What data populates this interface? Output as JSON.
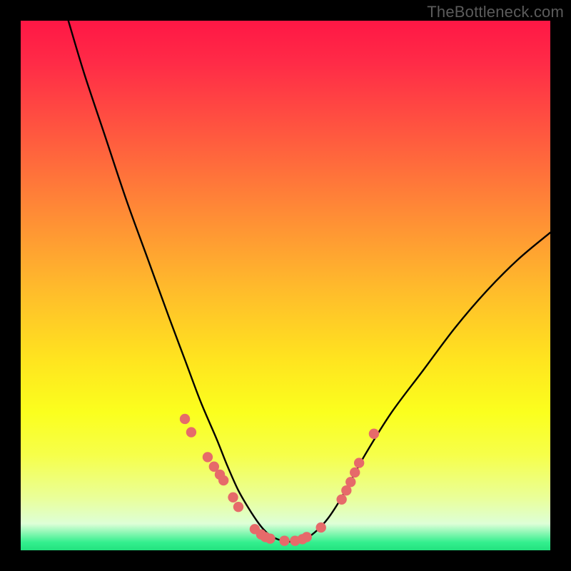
{
  "attribution": "TheBottleneck.com",
  "chart_data": {
    "type": "line",
    "title": "",
    "xlabel": "",
    "ylabel": "",
    "xlim": [
      0,
      100
    ],
    "ylim": [
      0,
      100
    ],
    "series": [
      {
        "name": "bottleneck-curve",
        "x": [
          9,
          12,
          16,
          20,
          24,
          28,
          31,
          34,
          37,
          39,
          41,
          43,
          45,
          46.5,
          48,
          50,
          52,
          54,
          56,
          58,
          60,
          62,
          65,
          70,
          76,
          82,
          88,
          94,
          100
        ],
        "y": [
          100,
          90,
          78,
          66,
          55,
          44,
          36,
          28,
          21,
          16,
          11.5,
          8,
          5,
          3.3,
          2.3,
          1.7,
          1.7,
          2.3,
          3.8,
          6,
          9,
          12.5,
          18,
          26,
          34,
          42,
          49,
          55,
          60
        ]
      }
    ],
    "markers": [
      {
        "side": "left",
        "x": 31.0,
        "y": 24.8
      },
      {
        "side": "left",
        "x": 32.2,
        "y": 22.3
      },
      {
        "side": "left",
        "x": 35.3,
        "y": 17.6
      },
      {
        "side": "left",
        "x": 36.5,
        "y": 15.8
      },
      {
        "side": "left",
        "x": 37.6,
        "y": 14.3
      },
      {
        "side": "left",
        "x": 38.3,
        "y": 13.2
      },
      {
        "side": "left",
        "x": 40.1,
        "y": 10.0
      },
      {
        "side": "left",
        "x": 41.1,
        "y": 8.2
      },
      {
        "side": "left",
        "x": 44.2,
        "y": 4.0
      },
      {
        "side": "left",
        "x": 45.4,
        "y": 3.0
      },
      {
        "side": "left",
        "x": 46.2,
        "y": 2.5
      },
      {
        "side": "left",
        "x": 47.1,
        "y": 2.2
      },
      {
        "side": "left",
        "x": 49.8,
        "y": 1.8
      },
      {
        "side": "right",
        "x": 51.8,
        "y": 1.8
      },
      {
        "side": "right",
        "x": 53.2,
        "y": 2.1
      },
      {
        "side": "right",
        "x": 54.0,
        "y": 2.5
      },
      {
        "side": "right",
        "x": 56.7,
        "y": 4.3
      },
      {
        "side": "right",
        "x": 60.6,
        "y": 9.6
      },
      {
        "side": "right",
        "x": 61.5,
        "y": 11.3
      },
      {
        "side": "right",
        "x": 62.3,
        "y": 12.9
      },
      {
        "side": "right",
        "x": 63.1,
        "y": 14.7
      },
      {
        "side": "right",
        "x": 63.9,
        "y": 16.5
      },
      {
        "side": "right",
        "x": 66.7,
        "y": 22.0
      }
    ],
    "colors": {
      "curve": "#000000",
      "marker_fill": "#e66a6a",
      "marker_stroke": "#bb4040"
    }
  }
}
